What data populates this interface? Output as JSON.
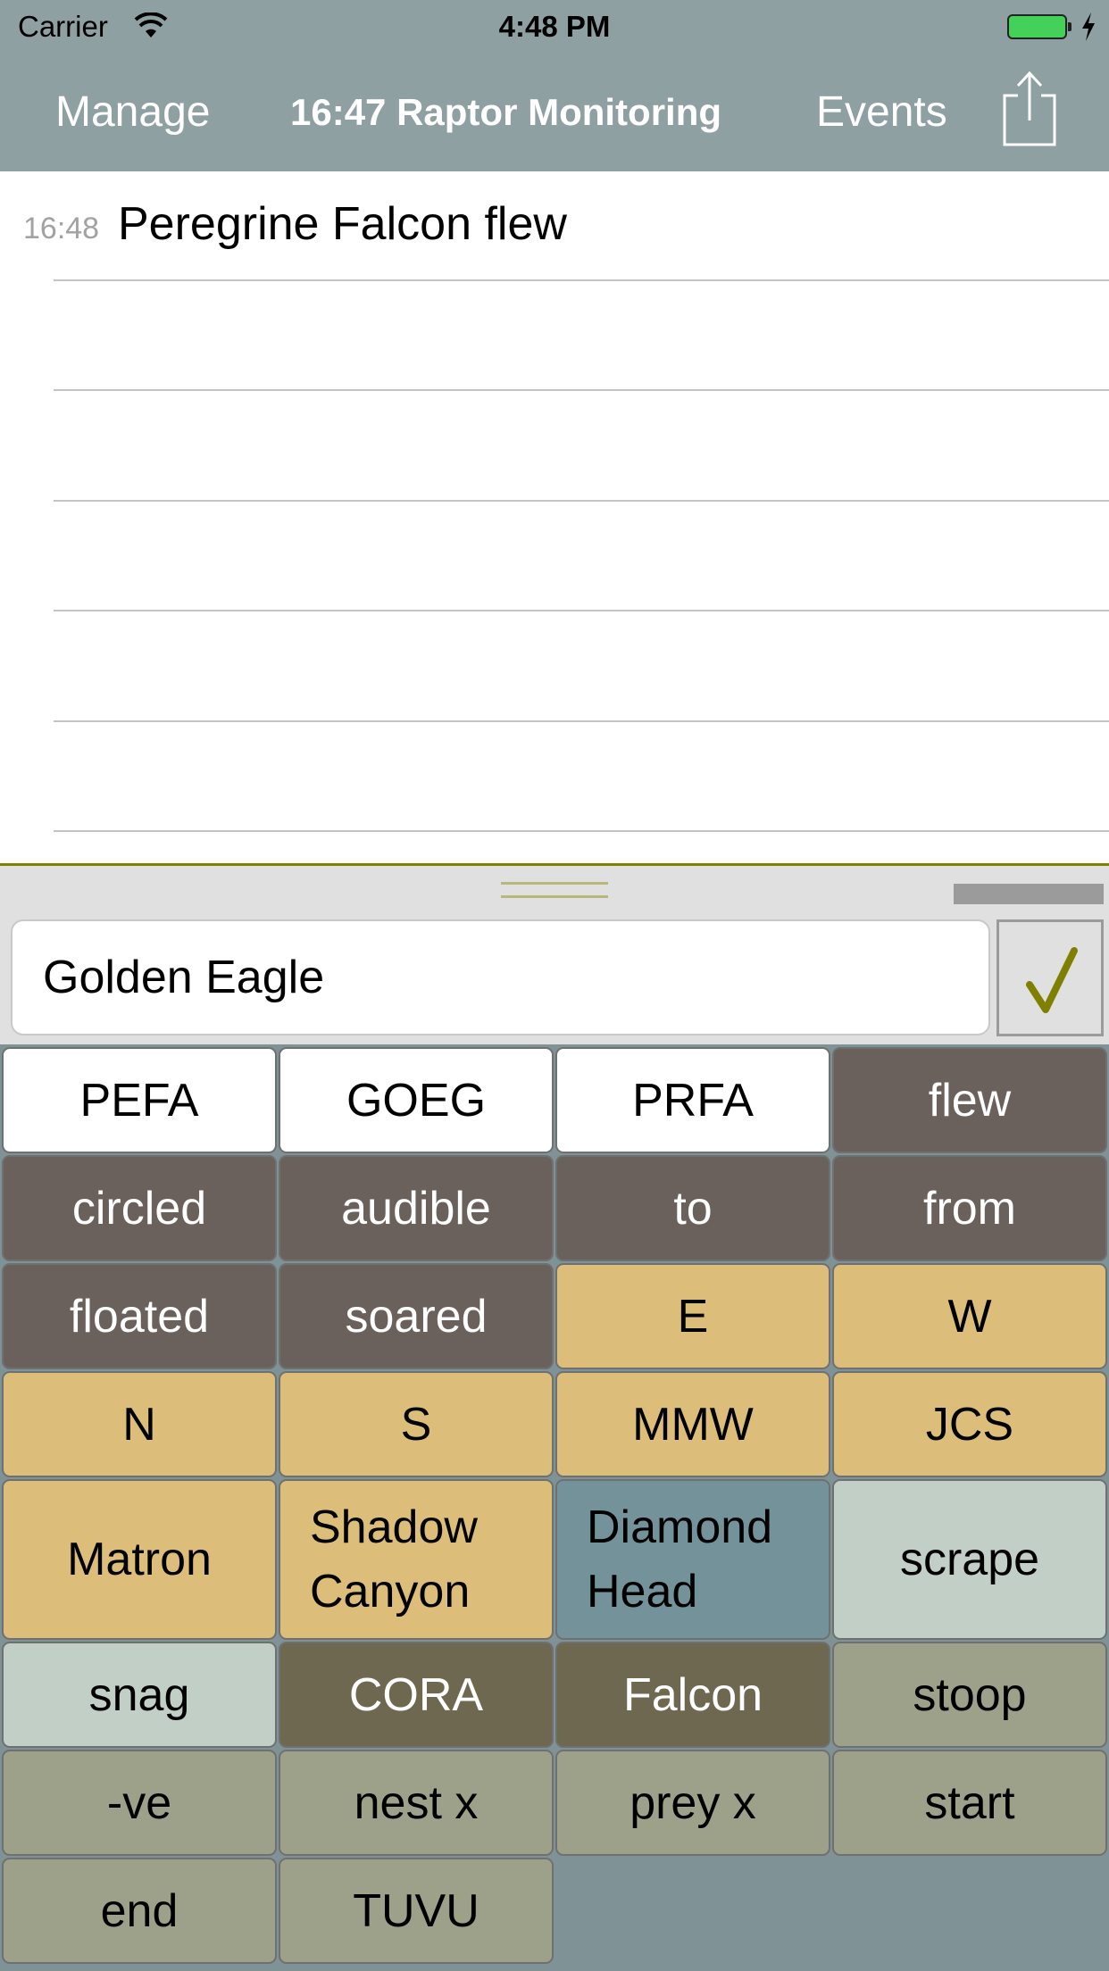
{
  "status_bar": {
    "carrier": "Carrier",
    "time": "4:48 PM",
    "battery_state": "charging",
    "battery_color": "#43d15a"
  },
  "nav": {
    "left_button": "Manage",
    "title": "16:47 Raptor Monitoring",
    "right_button": "Events",
    "share_icon": "share-icon"
  },
  "events": [
    {
      "time": "16:48",
      "text": "Peregrine Falcon flew"
    },
    {
      "time": "",
      "text": ""
    },
    {
      "time": "",
      "text": ""
    },
    {
      "time": "",
      "text": ""
    },
    {
      "time": "",
      "text": ""
    },
    {
      "time": "",
      "text": ""
    }
  ],
  "entry": {
    "value": "Golden Eagle",
    "submit_icon": "checkmark-icon"
  },
  "colors": {
    "nav_bg": "#8fa0a2",
    "accent": "#808000",
    "grid_bg": "#7f9296"
  },
  "buttons": [
    {
      "label": "PEFA",
      "color": "white"
    },
    {
      "label": "GOEG",
      "color": "white"
    },
    {
      "label": "PRFA",
      "color": "white"
    },
    {
      "label": "flew",
      "color": "dark"
    },
    {
      "label": "circled",
      "color": "dark"
    },
    {
      "label": "audible",
      "color": "dark"
    },
    {
      "label": "to",
      "color": "dark"
    },
    {
      "label": "from",
      "color": "dark"
    },
    {
      "label": "floated",
      "color": "dark"
    },
    {
      "label": "soared",
      "color": "dark"
    },
    {
      "label": "E",
      "color": "tan"
    },
    {
      "label": "W",
      "color": "tan"
    },
    {
      "label": "N",
      "color": "tan"
    },
    {
      "label": "S",
      "color": "tan"
    },
    {
      "label": "MMW",
      "color": "tan"
    },
    {
      "label": "JCS",
      "color": "tan"
    },
    {
      "label": "Matron",
      "color": "tan"
    },
    {
      "label": "Shadow Canyon",
      "color": "tan"
    },
    {
      "label": "Diamond Head",
      "color": "steel"
    },
    {
      "label": "scrape",
      "color": "lightsage"
    },
    {
      "label": "snag",
      "color": "lightsage"
    },
    {
      "label": "CORA",
      "color": "olive"
    },
    {
      "label": "Falcon",
      "color": "olive"
    },
    {
      "label": "stoop",
      "color": "sage"
    },
    {
      "label": "-ve",
      "color": "sage"
    },
    {
      "label": "nest x",
      "color": "sage"
    },
    {
      "label": "prey x",
      "color": "sage"
    },
    {
      "label": "start",
      "color": "sage"
    },
    {
      "label": "end",
      "color": "sage"
    },
    {
      "label": "TUVU",
      "color": "sage"
    }
  ]
}
